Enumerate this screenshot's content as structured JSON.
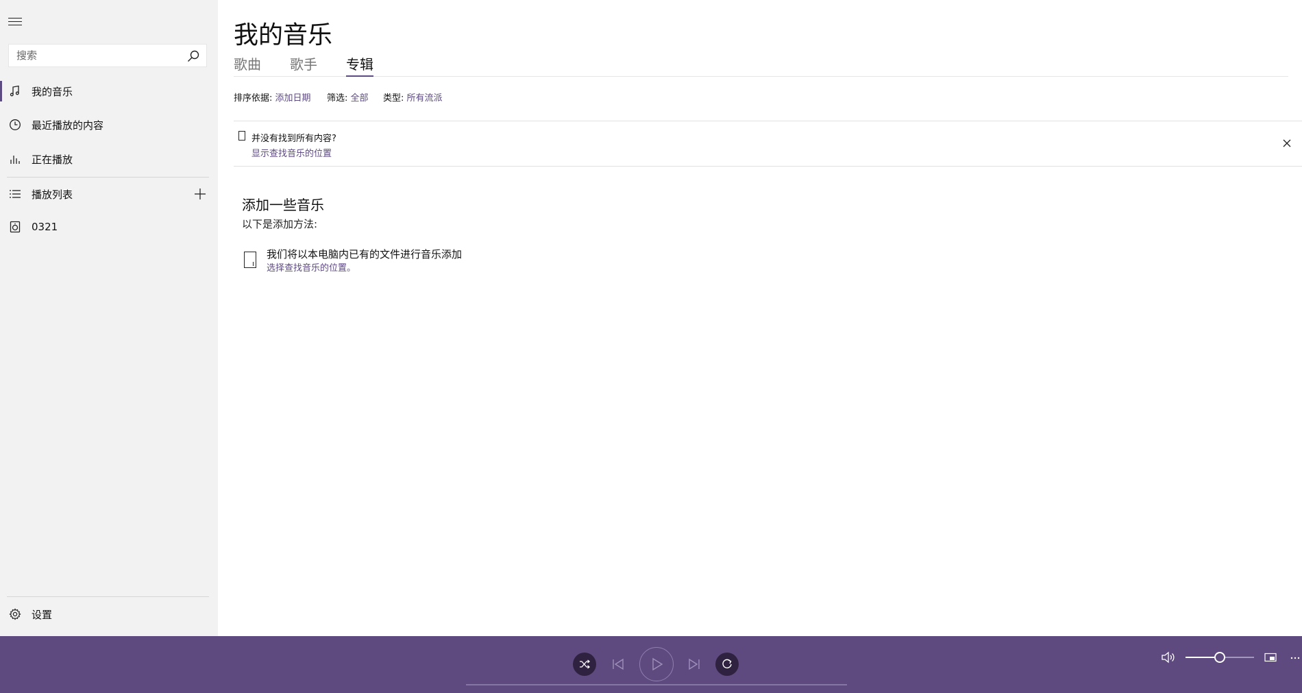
{
  "colors": {
    "accent": "#5c4a82",
    "player_bg": "#5f4a7f",
    "sidebar_bg": "#f2f2f2"
  },
  "sidebar": {
    "search": {
      "placeholder": "搜索",
      "value": ""
    },
    "items": [
      {
        "label": "我的音乐",
        "icon": "music-note-icon",
        "active": true
      },
      {
        "label": "最近播放的内容",
        "icon": "clock-icon"
      },
      {
        "label": "正在播放",
        "icon": "equalizer-icon"
      },
      {
        "label": "播放列表",
        "icon": "playlist-icon"
      },
      {
        "label": "0321",
        "icon": "speaker-icon"
      }
    ],
    "settings_label": "设置"
  },
  "main": {
    "title": "我的音乐",
    "tabs": [
      {
        "label": "歌曲"
      },
      {
        "label": "歌手"
      },
      {
        "label": "专辑",
        "active": true
      }
    ],
    "filters": {
      "sort_label": "排序依据:",
      "sort_value": "添加日期",
      "filter_label": "筛选:",
      "filter_value": "全部",
      "genre_label": "类型:",
      "genre_value": "所有流派"
    },
    "banner": {
      "text": "并没有找到所有内容?",
      "link": "显示查找音乐的位置"
    },
    "add": {
      "title": "添加一些音乐",
      "subtitle": "以下是添加方法:",
      "item_text": "我们将以本电脑内已有的文件进行音乐添加",
      "item_link": "选择查找音乐的位置。"
    }
  },
  "player": {
    "progress": 0,
    "volume": 0.5
  }
}
